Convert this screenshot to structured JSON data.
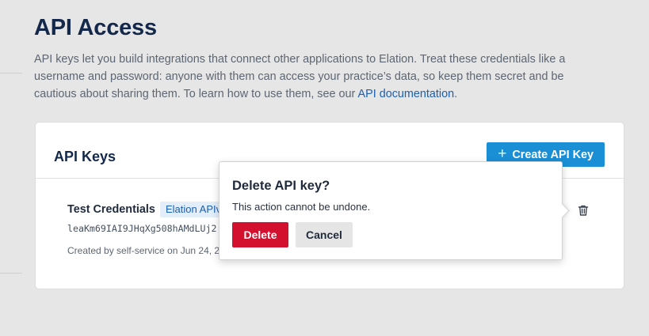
{
  "header": {
    "title": "API Access",
    "description_prefix": "API keys let you build integrations that connect other applications to Elation. Treat these credentials like a username and password: anyone with them can access your practice’s data, so keep them secret and be cautious about sharing them. To learn how to use them, see our ",
    "docs_link_label": "API documentation",
    "description_suffix": "."
  },
  "card": {
    "title": "API Keys",
    "create_button_label": "Create API Key",
    "create_button_icon": "plus-icon"
  },
  "api_key": {
    "name": "Test Credentials",
    "badge": "Elation APIv",
    "value": "leaKm69IAI9JHqXg508hAMdLUj2",
    "created": "Created by self-service on Jun 24, 2",
    "delete_icon": "trash-icon"
  },
  "confirm_popover": {
    "title": "Delete API key?",
    "message": "This action cannot be undone.",
    "confirm_label": "Delete",
    "cancel_label": "Cancel"
  },
  "colors": {
    "primary_button": "#1a8fd6",
    "danger_button": "#d3102d",
    "link": "#1a5fb4",
    "heading": "#13284a"
  }
}
